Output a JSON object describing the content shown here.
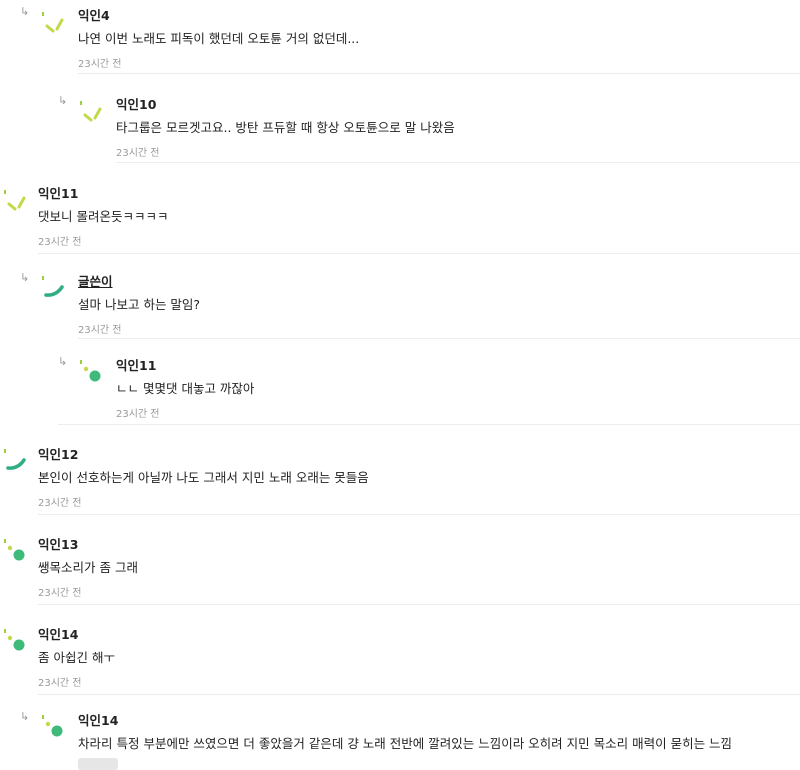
{
  "comments": [
    {
      "name": "익인4",
      "text": "나연 이번 노래도 피독이 했던데 오토튠 거의 없던데...",
      "time": "23시간 전"
    },
    {
      "name": "익인10",
      "text": "타그룹은 모르겟고요.. 방탄 프듀할 때 항상 오토튠으로 말 나왔음",
      "time": "23시간 전"
    },
    {
      "name": "익인11",
      "text": "댓보니 몰려온듯ㅋㅋㅋㅋ",
      "time": "23시간 전"
    },
    {
      "name": "글쓴이",
      "text": "설마 나보고 하는 말임?",
      "time": "23시간 전"
    },
    {
      "name": "익인11",
      "text": "ㄴㄴ 몇몇댓 대놓고 까잖아",
      "time": "23시간 전"
    },
    {
      "name": "익인12",
      "text": "본인이 선호하는게 아닐까 나도 그래서 지민 노래 오래는 못들음",
      "time": "23시간 전"
    },
    {
      "name": "익인13",
      "text": "쌩목소리가 좀 그래",
      "time": "23시간 전"
    },
    {
      "name": "익인14",
      "text": "좀 아쉽긴 해ㅜ",
      "time": "23시간 전"
    },
    {
      "name": "익인14",
      "text": "차라리 특정 부분에만 쓰였으면 더 좋았을거 같은데 걍 노래 전반에 깔려있는 느낌이라 오히려 지민 목소리 매력이 묻히는 느낌",
      "time": ""
    }
  ],
  "reply_arrow_glyph": "↳",
  "icons": {
    "avatar_a": "lime-sticks-icon",
    "avatar_b": "green-arc-icon",
    "avatar_c": "green-dots-icon"
  },
  "colors": {
    "lime": "#c4d94a",
    "green": "#3fba7a",
    "meta": "#9a9a9a"
  }
}
